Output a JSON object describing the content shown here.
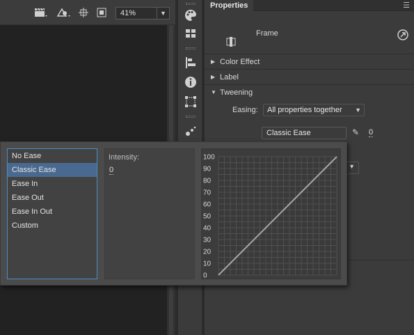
{
  "toolbar": {
    "zoom_value": "41%",
    "icons": [
      "clapper-icon",
      "pen-tool-icon",
      "center-stage-icon",
      "clip-icon"
    ]
  },
  "side_icons": [
    "color-palette-icon",
    "library-icon",
    "align-icon",
    "info-icon",
    "transform-icon",
    "motion-presets-icon"
  ],
  "properties": {
    "tab_title": "Properties",
    "frame_label": "Frame",
    "sections": {
      "color_effect": "Color Effect",
      "label": "Label",
      "tweening": "Tweening"
    },
    "easing": {
      "label": "Easing:",
      "selected": "All properties together",
      "ease_name": "Classic Ease",
      "ease_value": "0"
    }
  },
  "ease_popup": {
    "items": [
      "No Ease",
      "Classic Ease",
      "Ease In",
      "Ease Out",
      "Ease In Out",
      "Custom"
    ],
    "selected_index": 1,
    "intensity_label": "Intensity:",
    "intensity_value": "0"
  },
  "chart_data": {
    "type": "line",
    "x": [
      0,
      100
    ],
    "series": [
      {
        "values": [
          0,
          100
        ]
      }
    ],
    "y_ticks": [
      100,
      90,
      80,
      70,
      60,
      50,
      40,
      30,
      20,
      10,
      0
    ],
    "ylim": [
      0,
      100
    ],
    "xlim": [
      0,
      100
    ],
    "grid": true
  },
  "colors": {
    "accent": "#4b8ec7",
    "selection": "#4a6990",
    "curve": "#a8a8a8"
  }
}
